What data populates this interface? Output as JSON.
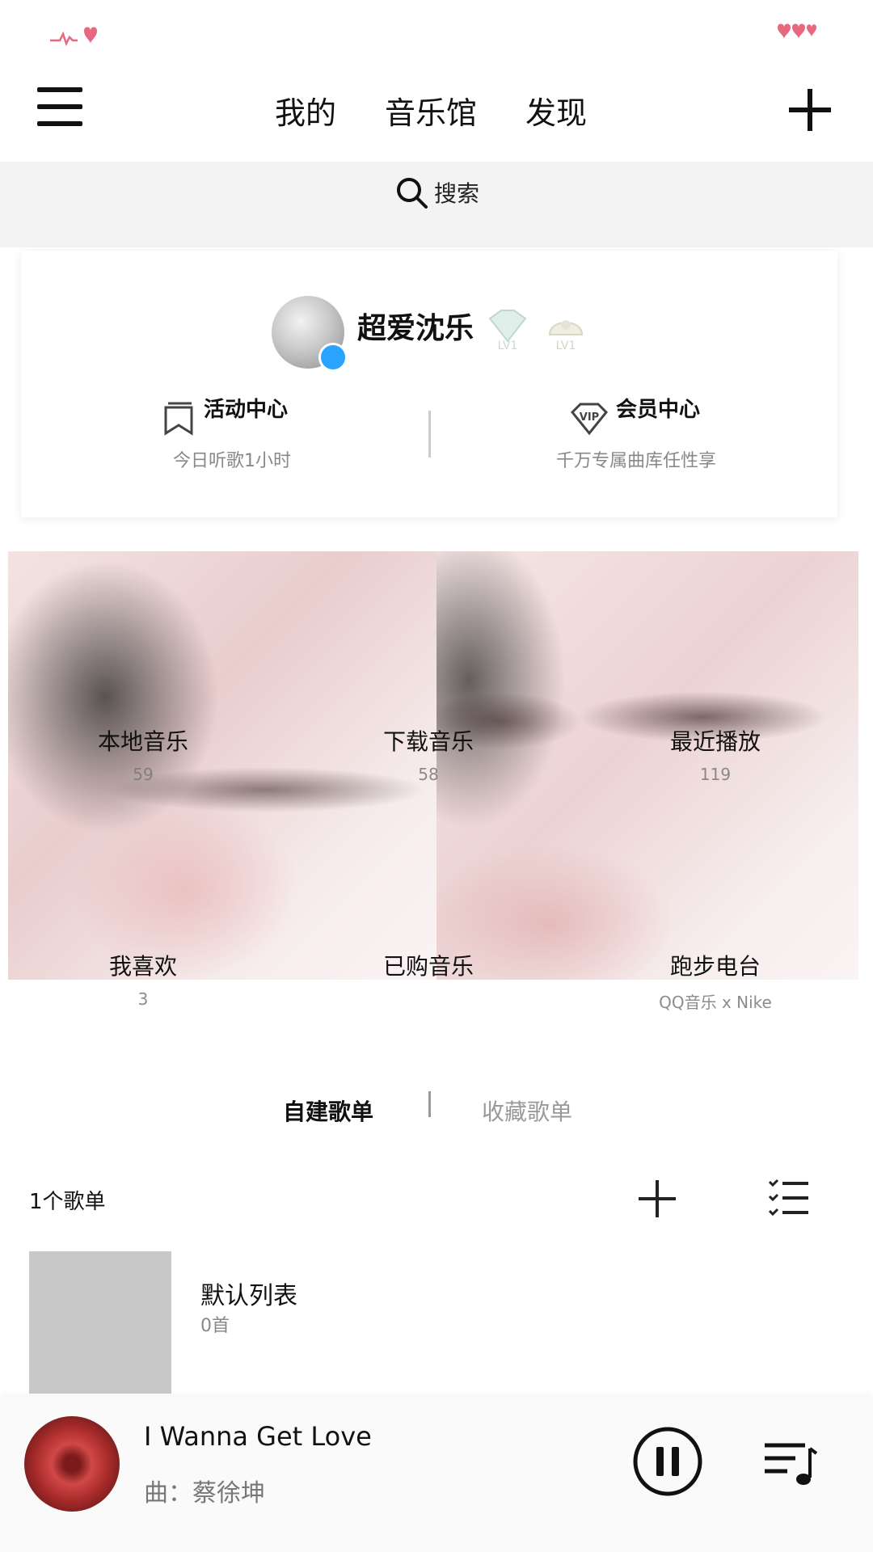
{
  "status_bar": {
    "left_icon": "heartbeat-icon",
    "right_icon": "hearts-icon"
  },
  "header": {
    "menu_icon": "menu-icon",
    "tabs": [
      {
        "label": "我的"
      },
      {
        "label": "音乐馆"
      },
      {
        "label": "发现"
      }
    ],
    "add_icon": "plus-icon"
  },
  "search": {
    "label": "搜索",
    "icon": "search-icon"
  },
  "profile": {
    "username": "超爱沈乐",
    "badges": [
      "LV1",
      "LV1"
    ],
    "activity": {
      "title": "活动中心",
      "subtitle": "今日听歌1小时"
    },
    "vip": {
      "title": "会员中心",
      "subtitle": "千万专属曲库任性享",
      "icon_text": "VIP"
    }
  },
  "grid": [
    {
      "label": "本地音乐",
      "count": "59"
    },
    {
      "label": "下载音乐",
      "count": "58"
    },
    {
      "label": "最近播放",
      "count": "119"
    },
    {
      "label": "我喜欢",
      "count": "3"
    },
    {
      "label": "已购音乐",
      "count": ""
    },
    {
      "label": "跑步电台",
      "count": "QQ音乐 x Nike"
    }
  ],
  "playlists": {
    "tabs": [
      {
        "label": "自建歌单"
      },
      {
        "label": "收藏歌单"
      }
    ],
    "count_label": "1个歌单",
    "items": [
      {
        "name": "默认列表",
        "songs": "0首"
      }
    ]
  },
  "player": {
    "title": "I Wanna Get Love",
    "artist": "曲：蔡徐坤",
    "state": "playing"
  },
  "colors": {
    "accent": "#e8687d",
    "text": "#111111",
    "muted": "#888888",
    "vip_badge": "#2aa3ff"
  }
}
